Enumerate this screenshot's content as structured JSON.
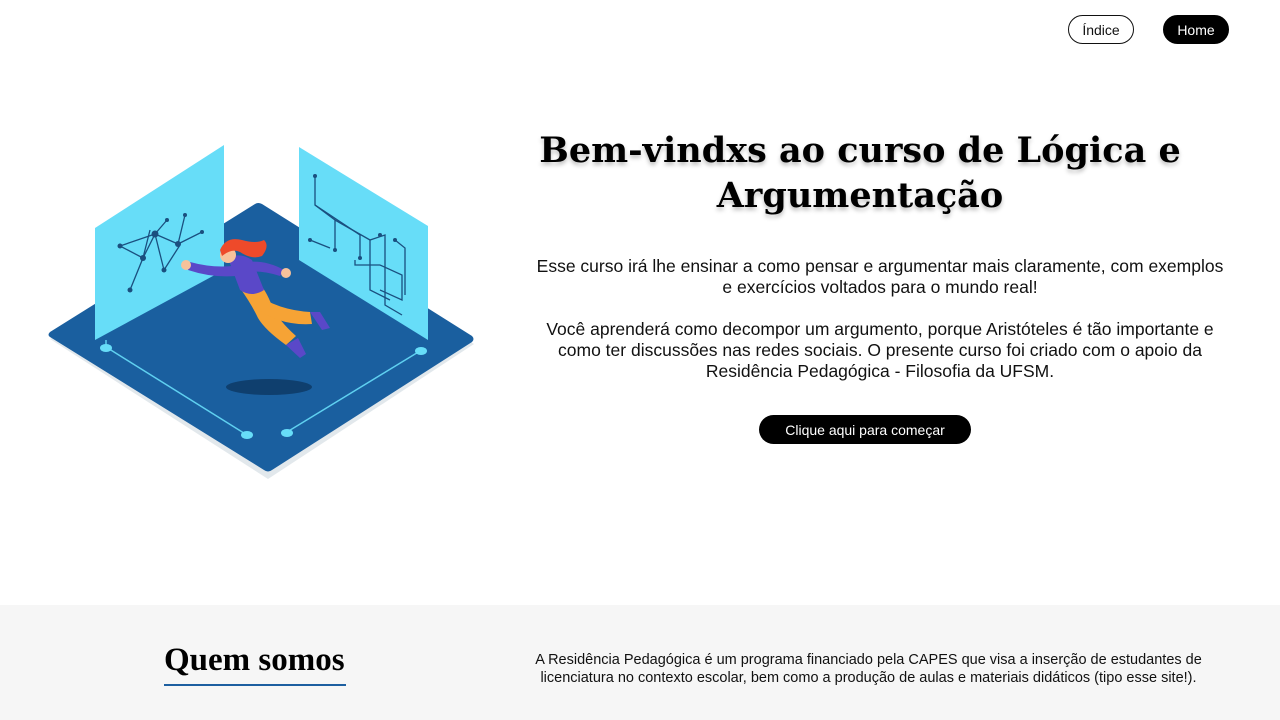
{
  "nav": {
    "indice_label": "Índice",
    "home_label": "Home"
  },
  "hero": {
    "title": "Bem-vindxs ao curso de Lógica e Argumentação",
    "paragraph1": "Esse curso irá lhe ensinar a como pensar e argumentar mais claramente, com exemplos e exercícios voltados para o mundo real!",
    "paragraph2": "Você aprenderá como decompor um argumento, porque Aristóteles é tão importante e como ter discussões nas redes sociais. O presente curso foi criado com o apoio da Residência Pedagógica - Filosofia da UFSM.",
    "cta_label": "Clique aqui para começar",
    "illustration": "isometric-woman-floating-between-panels"
  },
  "about": {
    "title": "Quem somos",
    "text": "A Residência Pedagógica é um programa financiado pela CAPES que visa a inserção de estudantes de licenciatura no contexto escolar, bem como a produção de aulas e materiais didáticos (tipo esse site!)."
  },
  "colors": {
    "primary": "#000000",
    "floor": "#1a5f9f",
    "panel": "#67ddf8",
    "accent_underline": "#1d5fa0",
    "footer_bg": "#f6f6f6"
  }
}
